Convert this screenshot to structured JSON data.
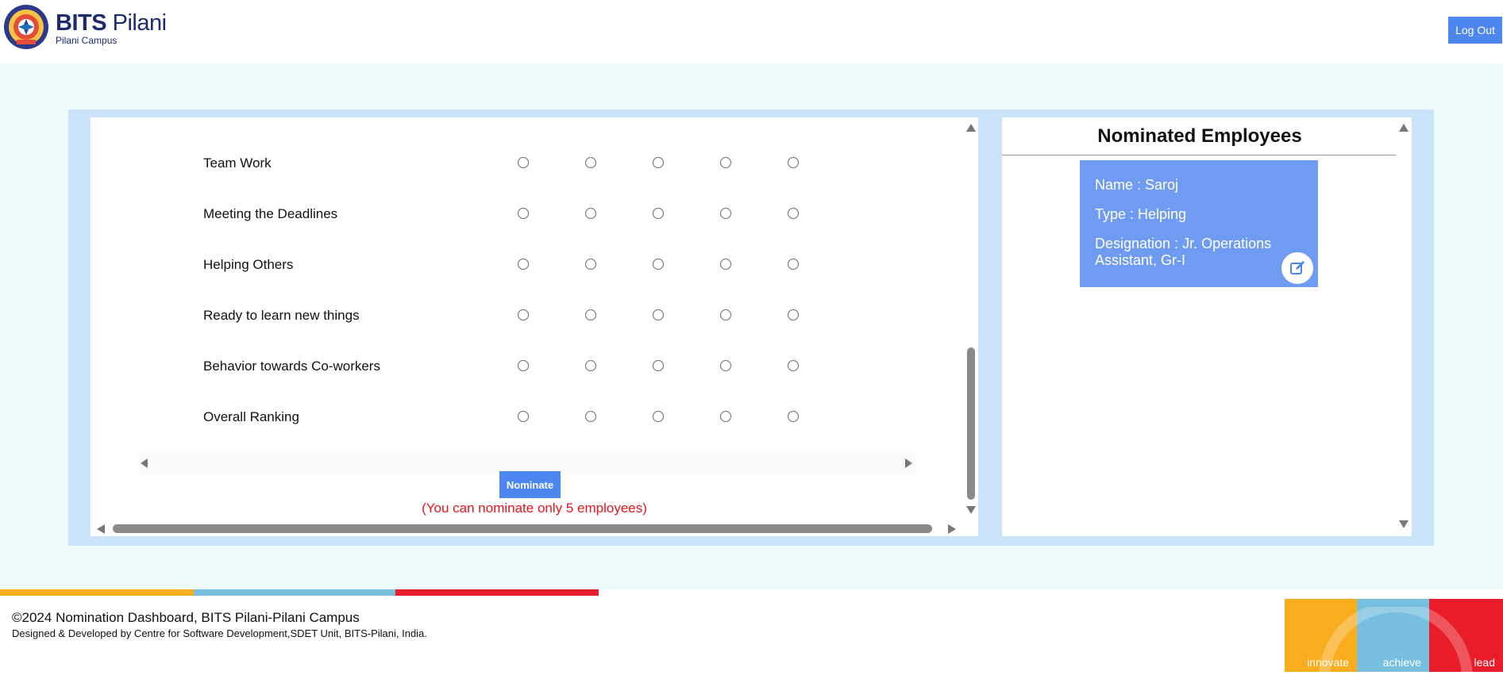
{
  "header": {
    "brand_title_bold": "BITS",
    "brand_title_rest": " Pilani",
    "brand_sub": "Pilani Campus",
    "logout_label": "Log Out"
  },
  "form": {
    "criteria": [
      {
        "label": "Team Work"
      },
      {
        "label": "Meeting the Deadlines"
      },
      {
        "label": "Helping Others"
      },
      {
        "label": "Ready to learn new things"
      },
      {
        "label": "Behavior towards Co-workers"
      },
      {
        "label": "Overall Ranking"
      }
    ],
    "nominate_label": "Nominate",
    "note": "(You can nominate only 5 employees)"
  },
  "nominated": {
    "title": "Nominated Employees",
    "cards": [
      {
        "name": "Name : Saroj",
        "type": "Type : Helping",
        "designation": "Designation : Jr. Operations Assistant, Gr-I"
      }
    ]
  },
  "footer": {
    "copyright": "©2024 Nomination Dashboard, BITS Pilani-Pilani Campus",
    "credit": "Designed & Developed by Centre for Software Development,SDET Unit, BITS-Pilani, India.",
    "badge": {
      "innovate": "innovate",
      "achieve": "achieve",
      "lead": "lead"
    }
  },
  "colors": {
    "accent_blue": "#4c86ee",
    "card_blue": "#6f9cf2",
    "note_red": "#e8141c",
    "stripe_yellow": "#f8ac1e",
    "stripe_blue": "#76bfdf",
    "stripe_red": "#e91c2a"
  }
}
